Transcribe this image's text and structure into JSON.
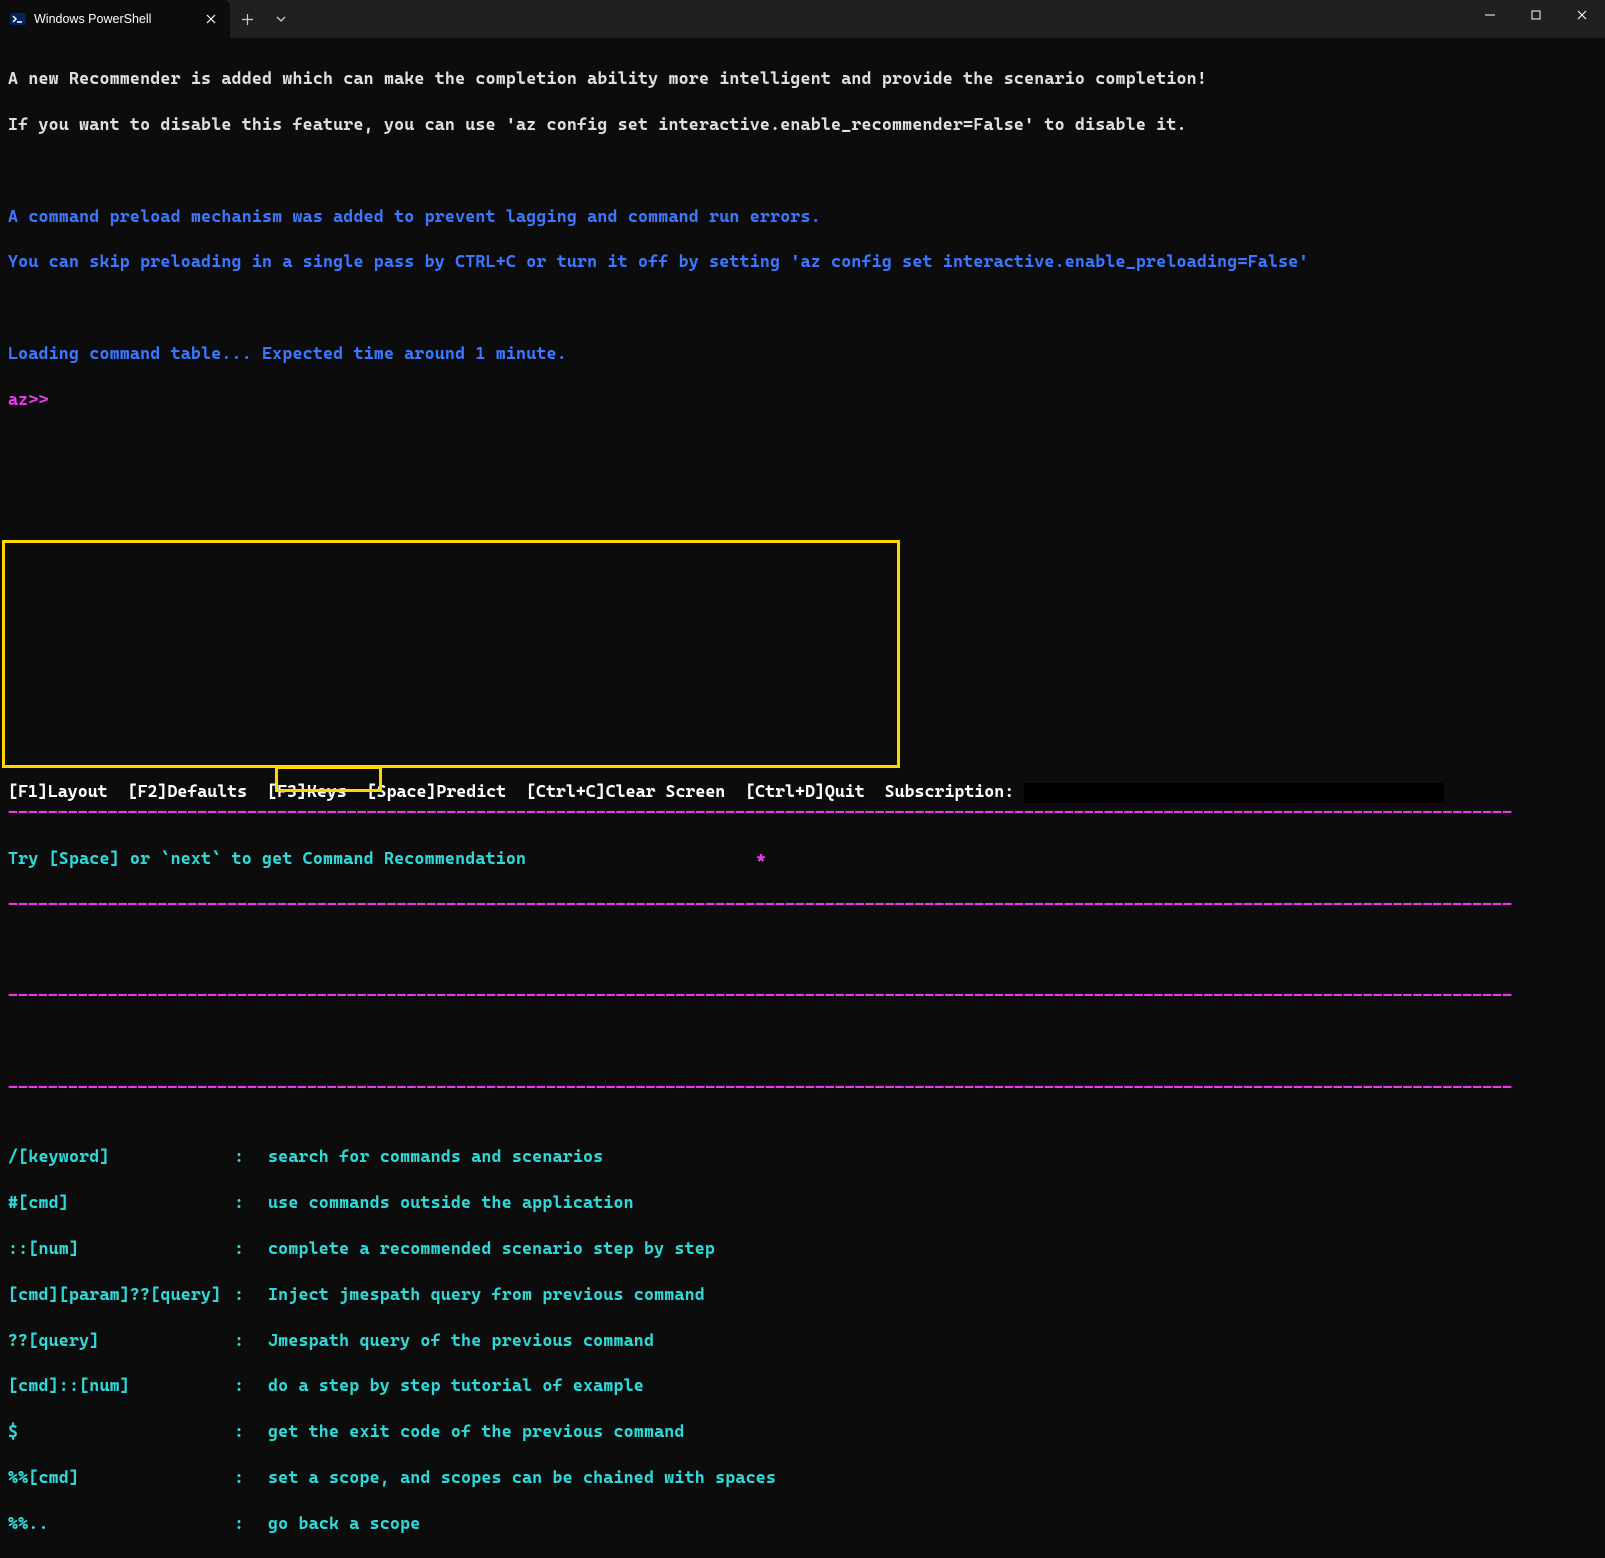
{
  "titlebar": {
    "tab_title": "Windows PowerShell"
  },
  "terminal": {
    "line1": "A new Recommender is added which can make the completion ability more intelligent and provide the scenario completion!",
    "line2": "If you want to disable this feature, you can use 'az config set interactive.enable_recommender=False' to disable it.",
    "line3": "A command preload mechanism was added to prevent lagging and command run errors.",
    "line4": "You can skip preloading in a single pass by CTRL+C or turn it off by setting 'az config set interactive.enable_preloading=False'",
    "line5": "Loading command table... Expected time around 1 minute.",
    "prompt": "az>>",
    "dashline": "-------------------------------------------------------------------------------------------------------------------------------------------------------",
    "recommend_line": "Try [Space] or `next` to get Command Recommendation",
    "star": "*"
  },
  "hints": [
    {
      "key": "/[keyword]",
      "sep": ":",
      "desc": "search for commands and scenarios"
    },
    {
      "key": "#[cmd]",
      "sep": ":",
      "desc": "use commands outside the application"
    },
    {
      "key": "::[num]",
      "sep": ":",
      "desc": "complete a recommended scenario step by step"
    },
    {
      "key": "[cmd][param]??[query]",
      "sep": ":",
      "desc": "Inject jmespath query from previous command"
    },
    {
      "key": "??[query]",
      "sep": ":",
      "desc": "Jmespath query of the previous command"
    },
    {
      "key": "[cmd]::[num]",
      "sep": ":",
      "desc": "do a step by step tutorial of example"
    },
    {
      "key": "$",
      "sep": ":",
      "desc": "get the exit code of the previous command"
    },
    {
      "key": "%%[cmd]",
      "sep": ":",
      "desc": "set a scope, and scopes can be chained with spaces"
    },
    {
      "key": "%%..",
      "sep": ":",
      "desc": "go back a scope"
    }
  ],
  "bottom_bar": {
    "f1": "[F1]Layout",
    "f2": "[F2]Defaults",
    "f3": "[F3]Keys",
    "space": "[Space]Predict",
    "ctrlc": "[Ctrl+C]Clear Screen",
    "ctrld": "[Ctrl+D]Quit",
    "subscription_label": "Subscription:"
  }
}
